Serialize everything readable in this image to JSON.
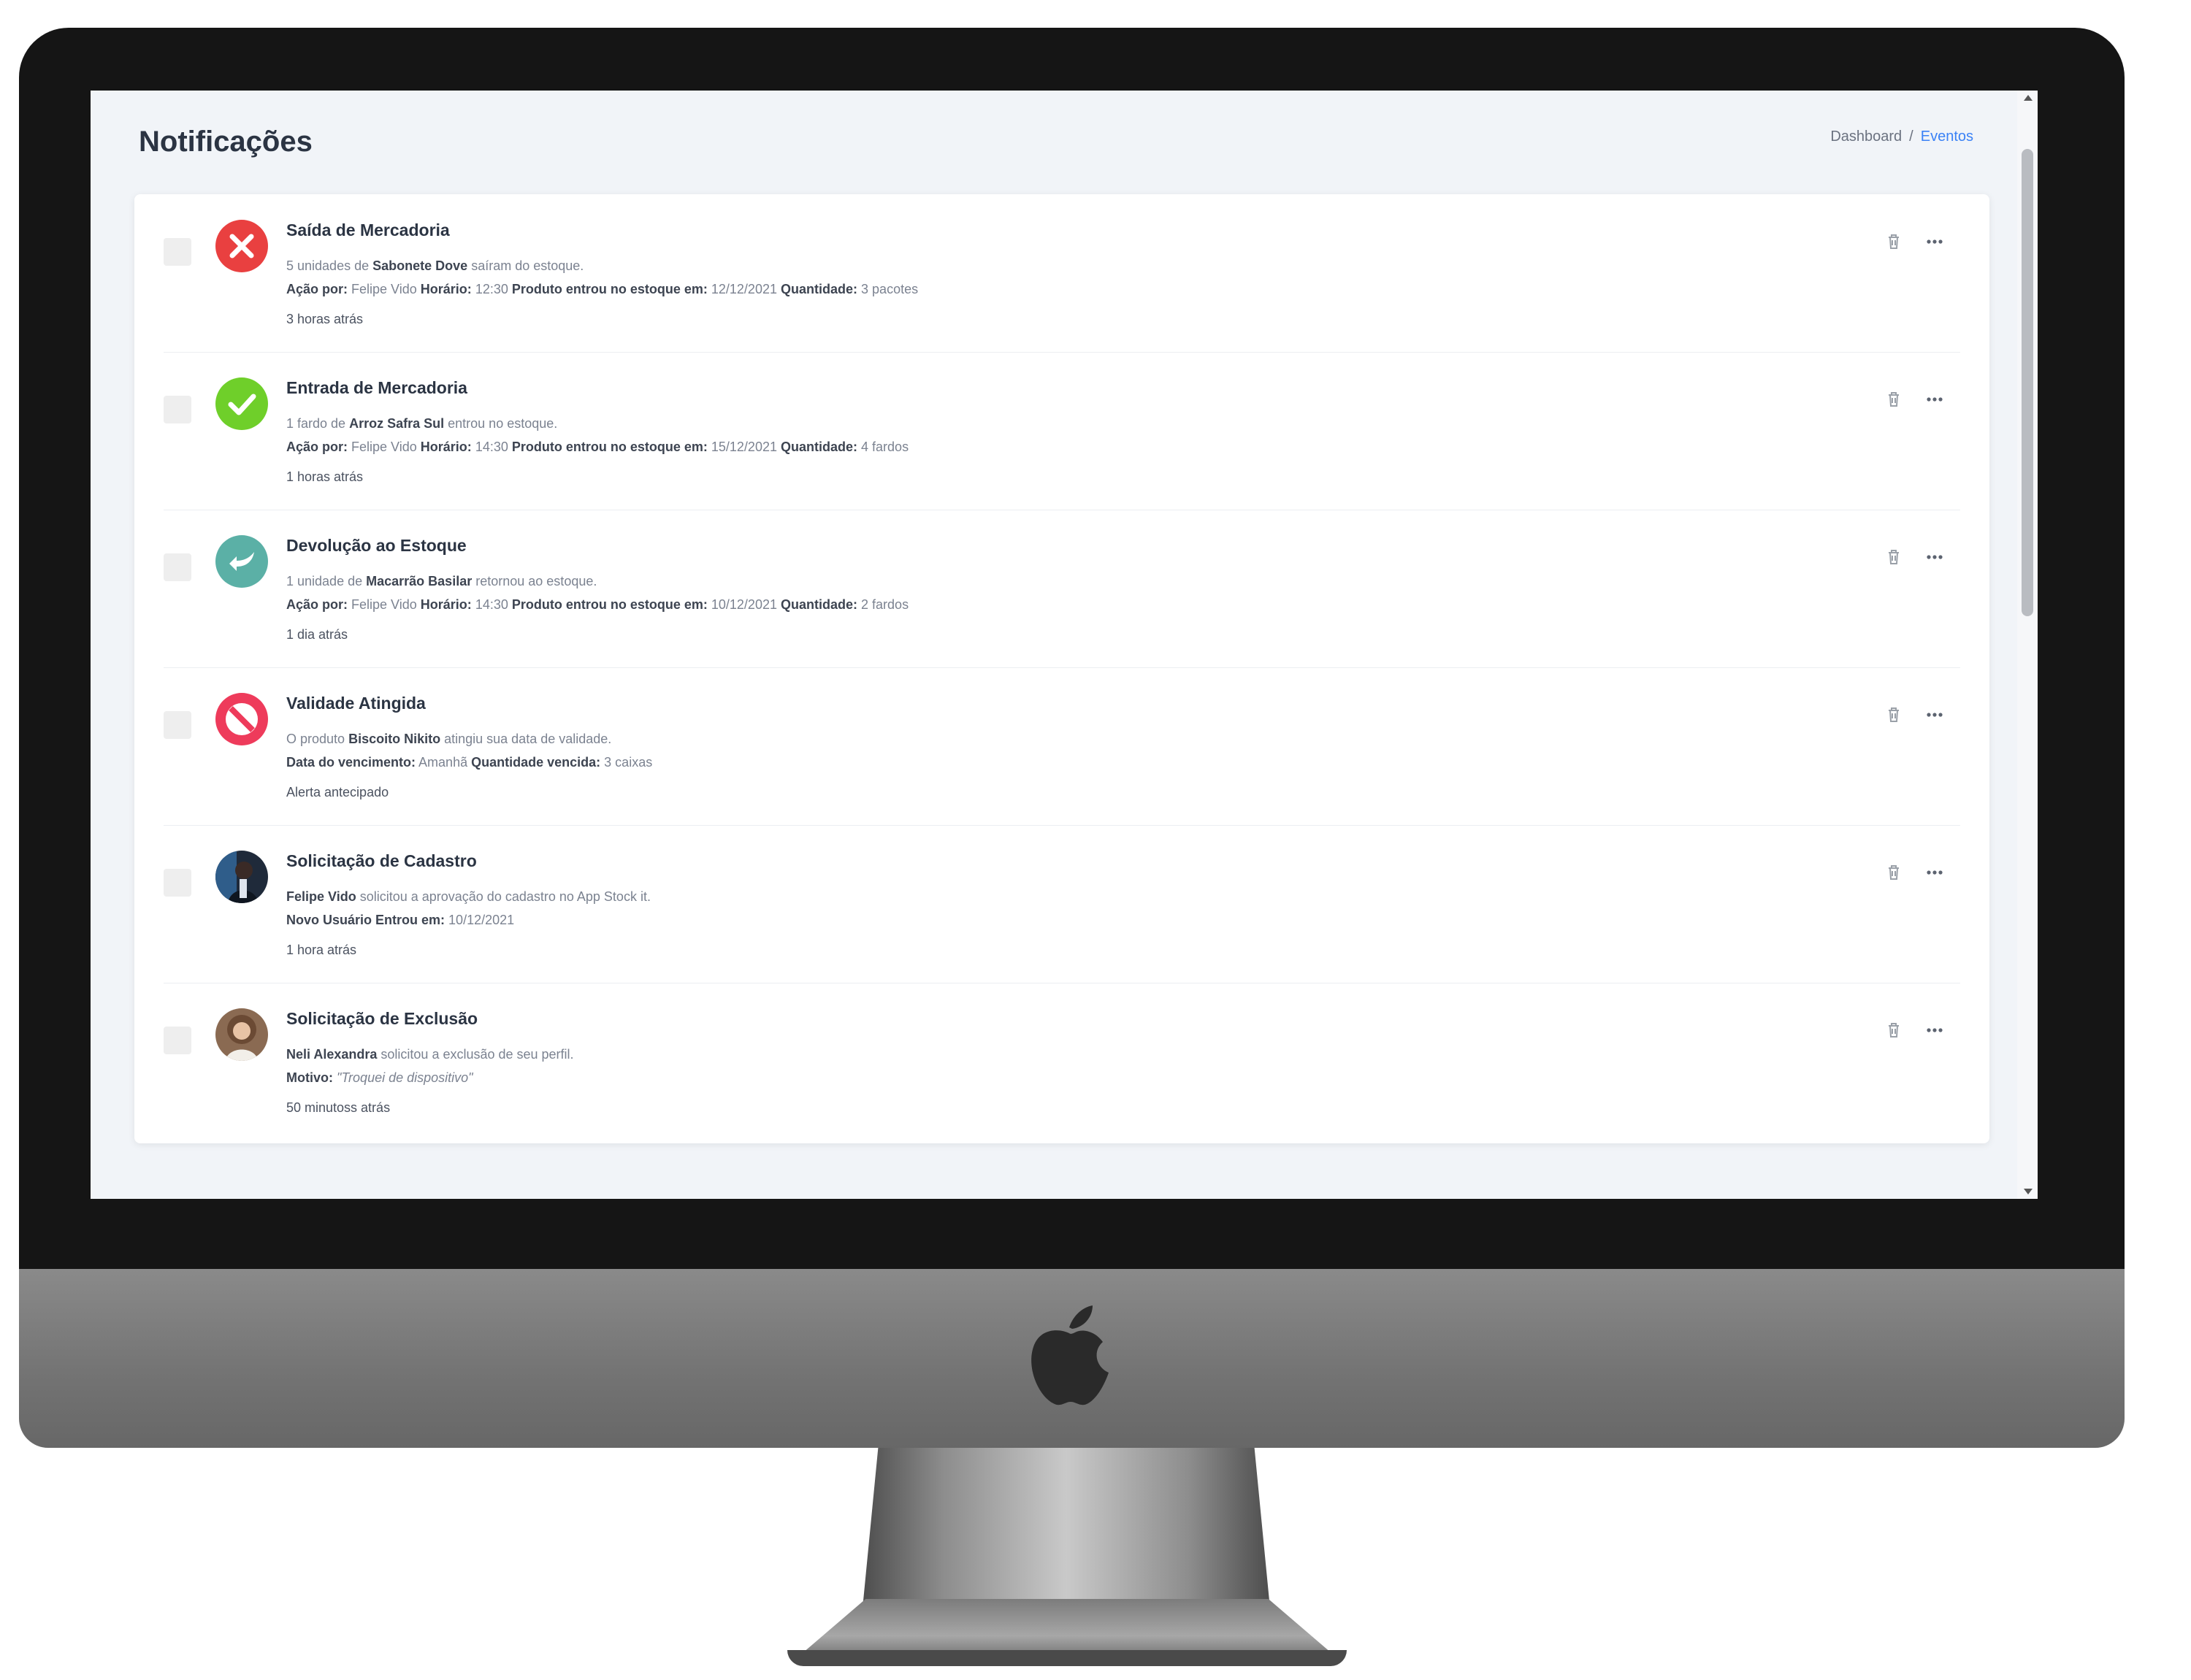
{
  "page": {
    "title": "Notificações",
    "breadcrumb": {
      "parent": "Dashboard",
      "separator": "/",
      "current": "Eventos"
    }
  },
  "colors": {
    "red": "#e94040",
    "green": "#6fcf2a",
    "teal": "#5bb0a6",
    "link": "#3b82f6"
  },
  "notifications": [
    {
      "icon": "x-circle-icon",
      "title": "Saída de Mercadoria",
      "desc": {
        "pre": "5 unidades de",
        "strong": "Sabonete Dove",
        "post": "saíram do estoque."
      },
      "details": [
        {
          "label": "Ação por:",
          "value": "Felipe Vido"
        },
        {
          "label": "Horário:",
          "value": "12:30"
        },
        {
          "label": "Produto entrou no estoque em:",
          "value": "12/12/2021"
        },
        {
          "label": "Quantidade:",
          "value": "3 pacotes"
        }
      ],
      "time": "3 horas atrás"
    },
    {
      "icon": "check-circle-icon",
      "title": "Entrada de Mercadoria",
      "desc": {
        "pre": "1 fardo de",
        "strong": "Arroz Safra Sul",
        "post": "entrou no estoque."
      },
      "details": [
        {
          "label": "Ação por:",
          "value": "Felipe Vido"
        },
        {
          "label": "Horário:",
          "value": "14:30"
        },
        {
          "label": "Produto entrou no estoque em:",
          "value": "15/12/2021"
        },
        {
          "label": "Quantidade:",
          "value": "4 fardos"
        }
      ],
      "time": "1 horas atrás"
    },
    {
      "icon": "return-arrow-icon",
      "title": "Devolução ao Estoque",
      "desc": {
        "pre": "1 unidade de",
        "strong": "Macarrão Basilar",
        "post": "retornou ao estoque."
      },
      "details": [
        {
          "label": "Ação por:",
          "value": "Felipe Vido"
        },
        {
          "label": "Horário:",
          "value": "14:30"
        },
        {
          "label": "Produto entrou no estoque em:",
          "value": "10/12/2021"
        },
        {
          "label": "Quantidade:",
          "value": "2 fardos"
        }
      ],
      "time": "1 dia atrás"
    },
    {
      "icon": "prohibited-icon",
      "title": "Validade Atingida",
      "desc": {
        "pre": "O produto",
        "strong": "Biscoito Nikito",
        "post": "atingiu sua data de validade."
      },
      "details": [
        {
          "label": "Data do vencimento:",
          "value": "Amanhã"
        },
        {
          "label": "Quantidade vencida:",
          "value": "3 caixas"
        }
      ],
      "time": "Alerta antecipado"
    },
    {
      "icon": "user-avatar-felipe",
      "title": "Solicitação de Cadastro",
      "desc": {
        "pre": "",
        "strong": "Felipe Vido",
        "post": "solicitou a aprovação do cadastro no App Stock it."
      },
      "details": [
        {
          "label": "Novo Usuário Entrou em:",
          "value": "10/12/2021"
        }
      ],
      "time": "1 hora atrás"
    },
    {
      "icon": "user-avatar-neli",
      "title": "Solicitação de Exclusão",
      "desc": {
        "pre": "",
        "strong": "Neli Alexandra",
        "post": "solicitou a exclusão de seu perfil."
      },
      "details": [
        {
          "label": "Motivo:",
          "value": "\"Troquei de dispositivo\""
        }
      ],
      "time": "50 minutoss atrás"
    }
  ]
}
